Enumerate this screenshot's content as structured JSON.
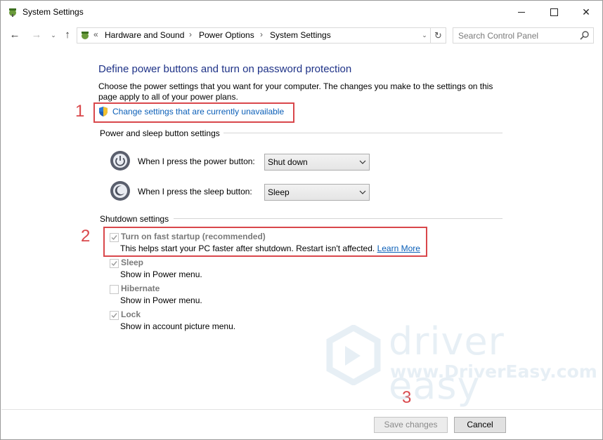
{
  "window": {
    "title": "System Settings",
    "controls": {
      "minimize": "",
      "maximize": "",
      "close": "✕"
    }
  },
  "nav": {
    "back": "←",
    "forward": "→",
    "recent": "⌄",
    "up": "↑",
    "address": {
      "prefix": "«",
      "crumbs": [
        "Hardware and Sound",
        "Power Options",
        "System Settings"
      ],
      "separator": "›"
    },
    "refresh": "↻",
    "search": {
      "placeholder": "Search Control Panel"
    }
  },
  "content": {
    "title": "Define power buttons and turn on password protection",
    "intro": "Choose the power settings that you want for your computer. The changes you make to the settings on this page apply to all of your power plans.",
    "change_link": "Change settings that are currently unavailable",
    "power_group": {
      "header": "Power and sleep button settings",
      "power_button": {
        "label": "When I press the power button:",
        "value": "Shut down"
      },
      "sleep_button": {
        "label": "When I press the sleep button:",
        "value": "Sleep"
      }
    },
    "shutdown_group": {
      "header": "Shutdown settings",
      "options": [
        {
          "label": "Turn on fast startup (recommended)",
          "desc": "This helps start your PC faster after shutdown. Restart isn't affected.",
          "link": "Learn More",
          "checked": true
        },
        {
          "label": "Sleep",
          "desc": "Show in Power menu.",
          "checked": true
        },
        {
          "label": "Hibernate",
          "desc": "Show in Power menu.",
          "checked": false
        },
        {
          "label": "Lock",
          "desc": "Show in account picture menu.",
          "checked": true
        }
      ]
    }
  },
  "annotations": {
    "one": "1",
    "two": "2",
    "three": "3",
    "color": "#d9474b"
  },
  "watermark": {
    "brand": "driver easy",
    "url": "www.DriverEasy.com"
  },
  "footer": {
    "save": "Save changes",
    "cancel": "Cancel"
  },
  "colors": {
    "title": "#1e3287",
    "link": "#0b5fb8",
    "disabled_label": "#7a7a7a"
  }
}
